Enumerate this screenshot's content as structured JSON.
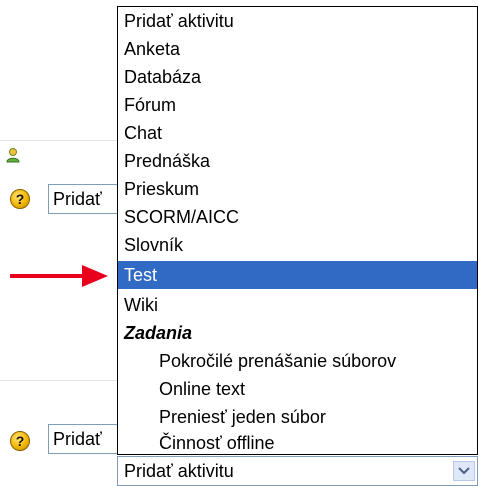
{
  "background": {
    "add_select_top_label": "Pridať",
    "add_select_bottom_label": "Pridať",
    "help_glyph": "?"
  },
  "dropdown": {
    "options": [
      {
        "label": "Pridať aktivitu"
      },
      {
        "label": "Anketa"
      },
      {
        "label": "Databáza"
      },
      {
        "label": "Fórum"
      },
      {
        "label": "Chat"
      },
      {
        "label": "Prednáška"
      },
      {
        "label": "Prieskum"
      },
      {
        "label": "SCORM/AICC"
      },
      {
        "label": "Slovník"
      },
      {
        "label": "Test"
      },
      {
        "label": "Wiki"
      },
      {
        "label": "Zadania"
      },
      {
        "label": "Pokročilé prenášanie súborov"
      },
      {
        "label": "Online text"
      },
      {
        "label": "Preniesť jeden súbor"
      },
      {
        "label": "Činnosť offline"
      }
    ],
    "selected": "Test",
    "selected_color": "#316ac5",
    "group_label": "Zadania"
  },
  "select": {
    "value": "Pridať aktivitu"
  },
  "colors": {
    "arrow": "#e8001c"
  }
}
